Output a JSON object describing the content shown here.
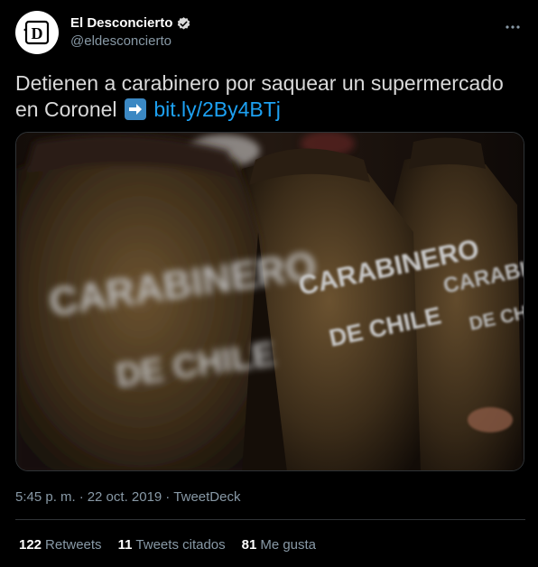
{
  "author": {
    "display_name": "El Desconcierto",
    "handle": "@eldesconcierto",
    "avatar_letter": "D",
    "verified_icon": "verified-badge-icon"
  },
  "tweet": {
    "text_before": "Detienen a carabinero por saquear un supermercado en Coronel",
    "emoji": "right-arrow-emoji",
    "link": "bit.ly/2By4BTj"
  },
  "media": {
    "description_text_top": "CARABINERO",
    "description_text_bottom": "DE CHILE"
  },
  "meta": {
    "time": "5:45 p. m.",
    "separator": "·",
    "date": "22 oct. 2019",
    "source": "TweetDeck"
  },
  "stats": {
    "retweets_count": "122",
    "retweets_label": "Retweets",
    "quotes_count": "11",
    "quotes_label": "Tweets citados",
    "likes_count": "81",
    "likes_label": "Me gusta"
  },
  "colors": {
    "background": "#000000",
    "link": "#1da1f2",
    "secondary": "#8899a6",
    "verified": "#d9d9d9"
  }
}
